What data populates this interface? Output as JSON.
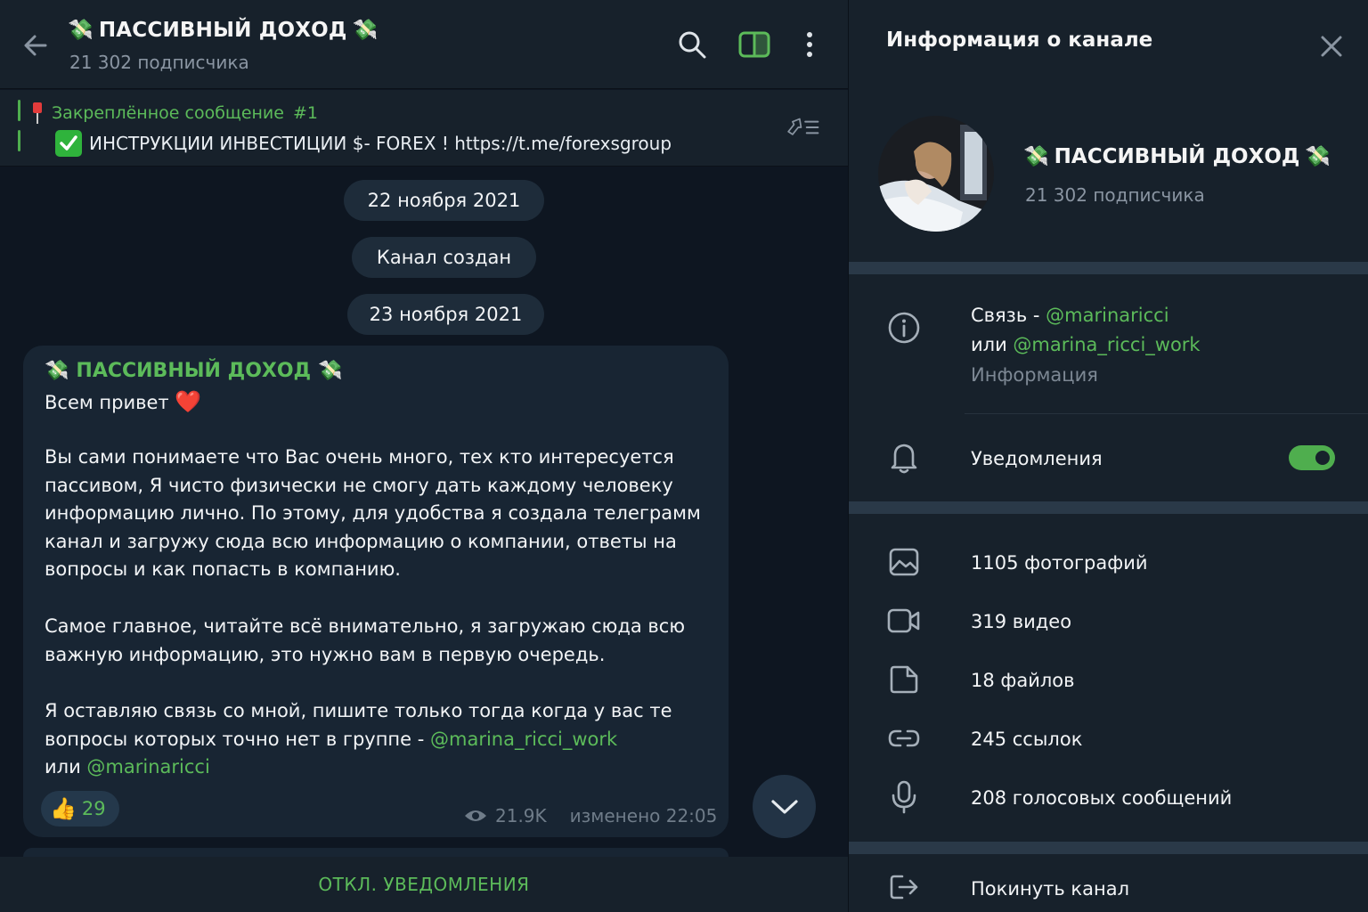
{
  "channel": {
    "emoji": "💸",
    "title": "ПАССИВНЫЙ ДОХОД",
    "subscribers": "21 302 подписчика"
  },
  "pinned": {
    "title": "Закреплённое сообщение",
    "number": "#1",
    "text": "ИНСТРУКЦИИ ИНВЕСТИЦИИ $- FOREX ! https://t.me/forexsgroup"
  },
  "service": {
    "date1": "22 ноября 2021",
    "created": "Канал создан",
    "date2": "23 ноября 2021"
  },
  "message": {
    "sender": "ПАССИВНЫЙ ДОХОД",
    "greeting": "Всем привет",
    "p1": "Вы сами понимаете что Вас очень много, тех кто интересуется пассивом, Я чисто физически не смогу дать каждому человеку информацию лично. По этому, для удобства я создала телеграмм канал и загружу сюда всю информацию о компании, ответы на вопросы и как попасть в компанию.",
    "p2": "Самое главное, читайте всё внимательно,  я загружаю сюда всю важную информацию, это нужно вам в первую очередь.",
    "p3": "Я оставляю связь со мной, пишите только тогда когда у вас те вопросы которых точно нет в группе - ",
    "link1": "@marina_ricci_work",
    "or": "или ",
    "link2": "@marinaricci",
    "reaction_emoji": "👍",
    "reaction_count": "29",
    "views": "21.9K",
    "edited": "изменено 22:05"
  },
  "bottom_action": "ОТКЛ. УВЕДОМЛЕНИЯ",
  "info": {
    "title": "Информация о канале",
    "contact_prefix": "Связь - ",
    "contact_link1": "@marinaricci",
    "contact_or": "или ",
    "contact_link2": "@marina_ricci_work",
    "contact_caption": "Информация",
    "notifications": "Уведомления",
    "notifications_on": true,
    "photos": "1105 фотографий",
    "videos": "319 видео",
    "files": "18 файлов",
    "links": "245 ссылок",
    "voice": "208 голосовых сообщений",
    "leave": "Покинуть канал"
  },
  "colors": {
    "accent": "#5cbb5a",
    "background": "#0e1621",
    "panel": "#17212b",
    "bubble": "#182533"
  }
}
